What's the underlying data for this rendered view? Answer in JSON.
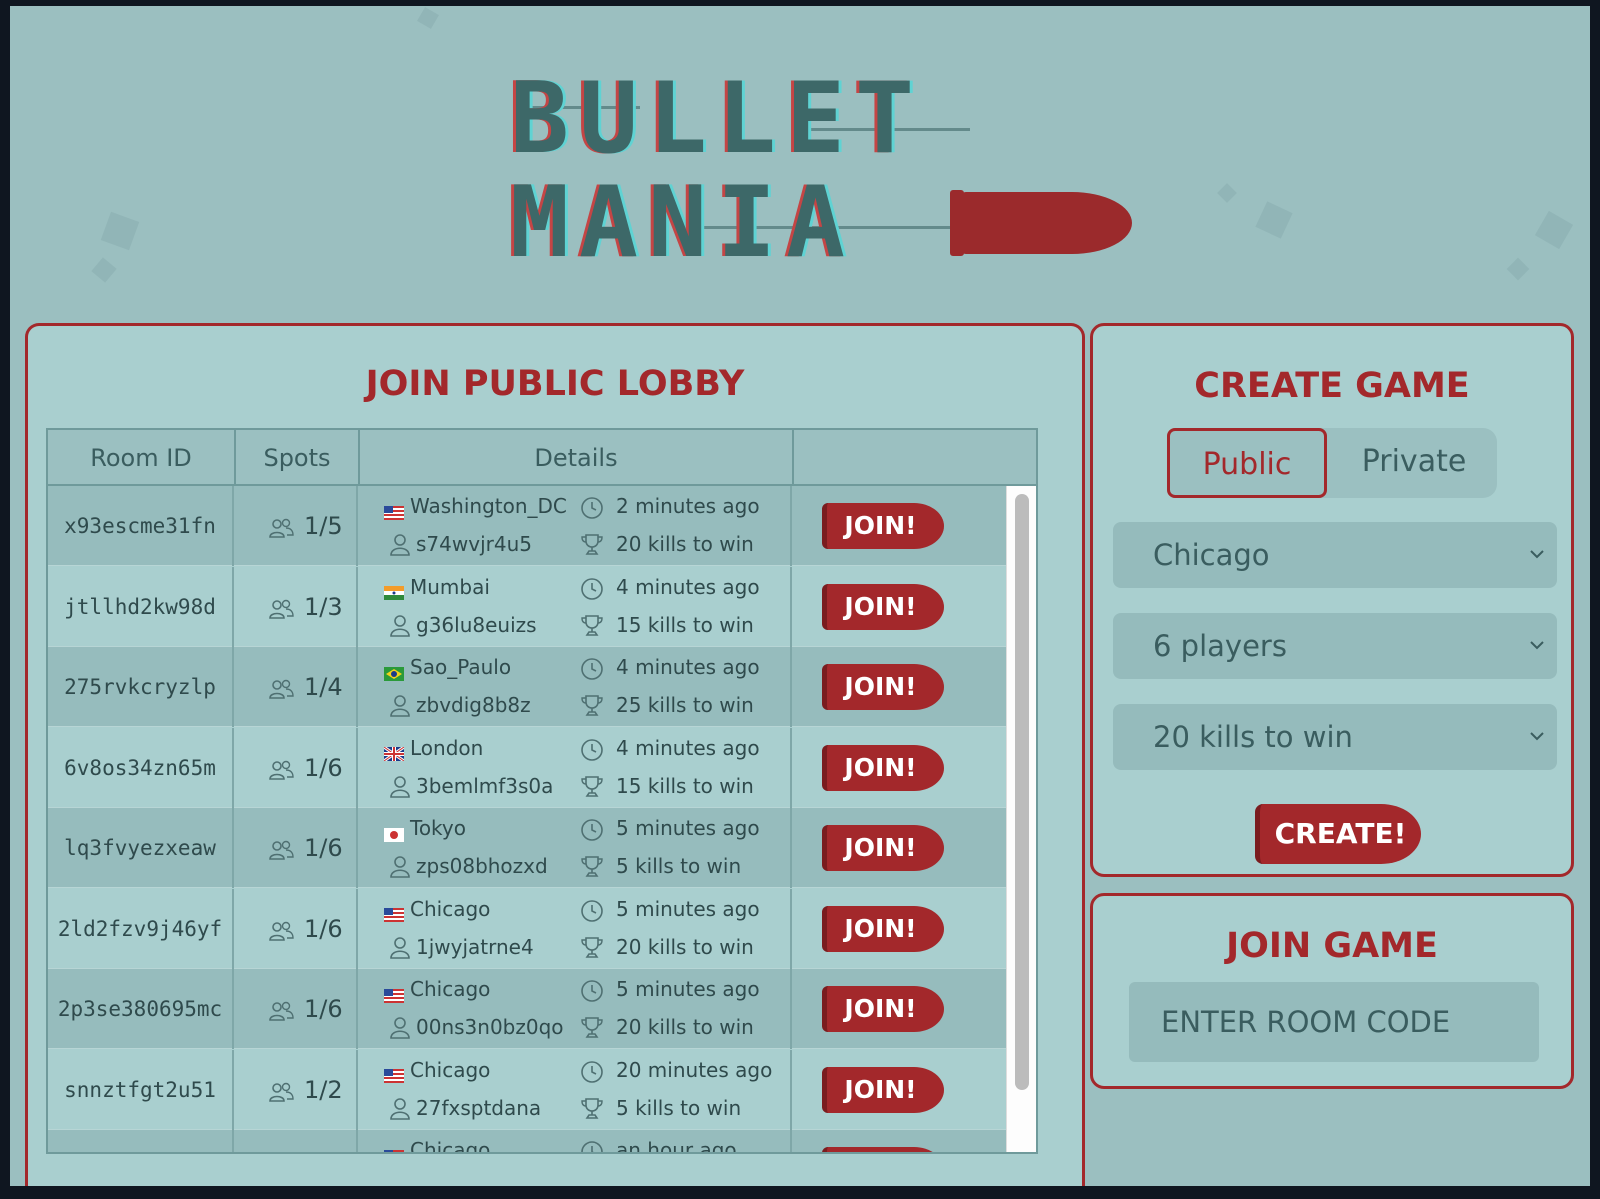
{
  "logo": {
    "line1": "BULLET",
    "line2": "MANIA",
    "accent": "#9b2a2c"
  },
  "lobby": {
    "title": "JOIN PUBLIC LOBBY",
    "columns": [
      "Room ID",
      "Spots",
      "Details",
      ""
    ],
    "join_label": "JOIN!",
    "rows": [
      {
        "id": "x93escme31fn",
        "spots": "1/5",
        "flag": "US",
        "region": "Washington_DC",
        "host": "s74wvjr4u5",
        "time": "2 minutes ago",
        "goal": "20 kills to win"
      },
      {
        "id": "jtllhd2kw98d",
        "spots": "1/3",
        "flag": "IN",
        "region": "Mumbai",
        "host": "g36lu8euizs",
        "time": "4 minutes ago",
        "goal": "15 kills to win"
      },
      {
        "id": "275rvkcryzlp",
        "spots": "1/4",
        "flag": "BR",
        "region": "Sao_Paulo",
        "host": "zbvdig8b8z",
        "time": "4 minutes ago",
        "goal": "25 kills to win"
      },
      {
        "id": "6v8os34zn65m",
        "spots": "1/6",
        "flag": "GB",
        "region": "London",
        "host": "3bemlmf3s0a",
        "time": "4 minutes ago",
        "goal": "15 kills to win"
      },
      {
        "id": "lq3fvyezxeaw",
        "spots": "1/6",
        "flag": "JP",
        "region": "Tokyo",
        "host": "zps08bhozxd",
        "time": "5 minutes ago",
        "goal": "5 kills to win"
      },
      {
        "id": "2ld2fzv9j46yf",
        "spots": "1/6",
        "flag": "US",
        "region": "Chicago",
        "host": "1jwyjatrne4",
        "time": "5 minutes ago",
        "goal": "20 kills to win"
      },
      {
        "id": "2p3se380695mc",
        "spots": "1/6",
        "flag": "US",
        "region": "Chicago",
        "host": "00ns3n0bz0qo",
        "time": "5 minutes ago",
        "goal": "20 kills to win"
      },
      {
        "id": "snnztfgt2u51",
        "spots": "1/2",
        "flag": "US",
        "region": "Chicago",
        "host": "27fxsptdana",
        "time": "20 minutes ago",
        "goal": "5 kills to win"
      },
      {
        "id": "",
        "spots": "",
        "flag": "US",
        "region": "Chicago",
        "host": "",
        "time": "an hour ago",
        "goal": ""
      }
    ]
  },
  "create": {
    "title": "CREATE GAME",
    "visibility": {
      "public": "Public",
      "private": "Private",
      "selected": "Public"
    },
    "region": "Chicago",
    "players": "6 players",
    "kills": "20 kills to win",
    "button": "CREATE!"
  },
  "join_game": {
    "title": "JOIN GAME",
    "placeholder": "ENTER ROOM CODE"
  },
  "colors": {
    "accent": "#a3282b",
    "panel": "#a9cfcf",
    "background": "#9bbfc0"
  }
}
